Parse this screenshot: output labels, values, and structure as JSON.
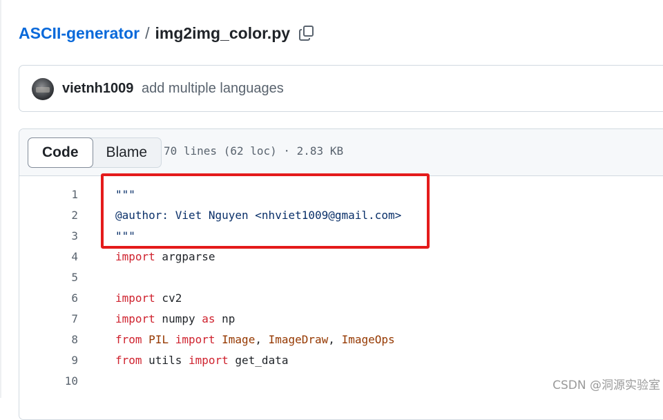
{
  "breadcrumb": {
    "repo": "ASCII-generator",
    "separator": "/",
    "file": "img2img_color.py"
  },
  "commit": {
    "author": "vietnh1009",
    "message": "add multiple languages"
  },
  "file_header": {
    "code_tab": "Code",
    "blame_tab": "Blame",
    "meta": "70 lines (62 loc) · 2.83 KB"
  },
  "code": {
    "line_numbers": [
      "1",
      "2",
      "3",
      "4",
      "5",
      "6",
      "7",
      "8",
      "9",
      "10"
    ],
    "line1": {
      "t1": "\"\"\""
    },
    "line2": {
      "t1": "@author: Viet Nguyen <nhviet1009@gmail.com>"
    },
    "line3": {
      "t1": "\"\"\""
    },
    "line4": {
      "t1": "import",
      "t2": " argparse"
    },
    "line6": {
      "t1": "import",
      "t2": " cv2"
    },
    "line7": {
      "t1": "import",
      "t2": " numpy ",
      "t3": "as",
      "t4": " np"
    },
    "line8": {
      "t1": "from",
      "t2": " ",
      "t3": "PIL",
      "t4": " ",
      "t5": "import",
      "t6": " ",
      "t7": "Image",
      "t8": ", ",
      "t9": "ImageDraw",
      "t10": ", ",
      "t11": "ImageOps"
    },
    "line9": {
      "t1": "from",
      "t2": " utils ",
      "t3": "import",
      "t4": " get_data"
    }
  },
  "watermark": "CSDN @洞源实验室",
  "colors": {
    "link": "#0969da",
    "keyword": "#cf222e",
    "class_name": "#953800",
    "string": "#0a3069",
    "highlight_border": "#e41b1b"
  },
  "icons": {
    "copy": "copy-icon",
    "avatar": "avatar"
  }
}
